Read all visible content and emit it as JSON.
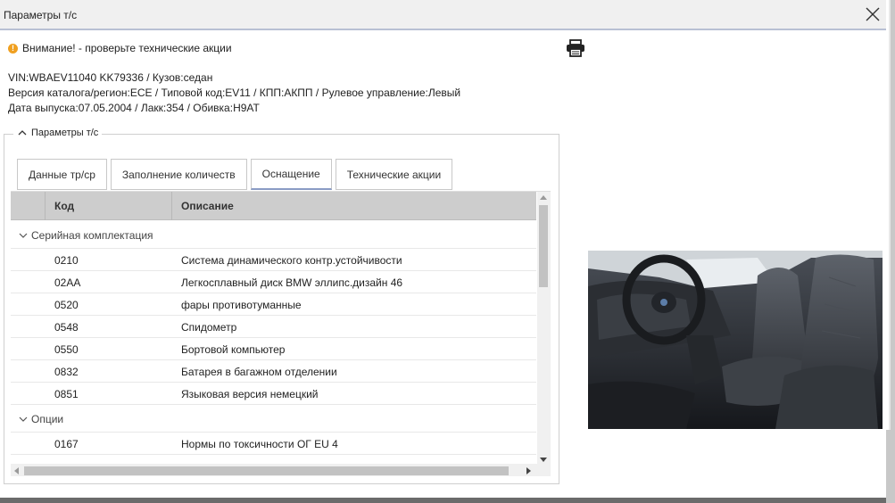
{
  "window": {
    "title": "Параметры т/с"
  },
  "warning": {
    "text": "Внимание! - проверьте технические акции"
  },
  "vehicle": {
    "line1": "VIN:WBAEV11040 KK79336 / Кузов:седан",
    "line2": "Версия каталога/регион:ECE / Типовой код:EV11 / КПП:АКПП / Рулевое управление:Левый",
    "line3": "Дата выпуска:07.05.2004 / Лакк:354 / Обивка:H9AT"
  },
  "section": {
    "legend": "Параметры т/с"
  },
  "tabs": [
    {
      "label": "Данные тр/ср"
    },
    {
      "label": "Заполнение количеств"
    },
    {
      "label": "Оснащение"
    },
    {
      "label": "Технические акции"
    }
  ],
  "table": {
    "headers": {
      "code": "Код",
      "description": "Описание"
    },
    "groups": [
      {
        "label": "Серийная комплектация",
        "rows": [
          {
            "code": "0210",
            "description": "Система динамического контр.устойчивости"
          },
          {
            "code": "02AA",
            "description": "Легкосплавный диск BMW эллипс.дизайн 46"
          },
          {
            "code": "0520",
            "description": "фары противотуманные"
          },
          {
            "code": "0548",
            "description": "Спидометр"
          },
          {
            "code": "0550",
            "description": "Бортовой компьютер"
          },
          {
            "code": "0832",
            "description": "Батарея в багажном отделении"
          },
          {
            "code": "0851",
            "description": "Языковая версия немецкий"
          }
        ]
      },
      {
        "label": "Опции",
        "rows": [
          {
            "code": "0167",
            "description": "Нормы по токсичности ОГ EU 4"
          }
        ]
      }
    ]
  },
  "colors": {
    "header_bg": "#cdcdcd",
    "active_tab_underline": "#8a9bc4",
    "warning": "#f0a020"
  }
}
